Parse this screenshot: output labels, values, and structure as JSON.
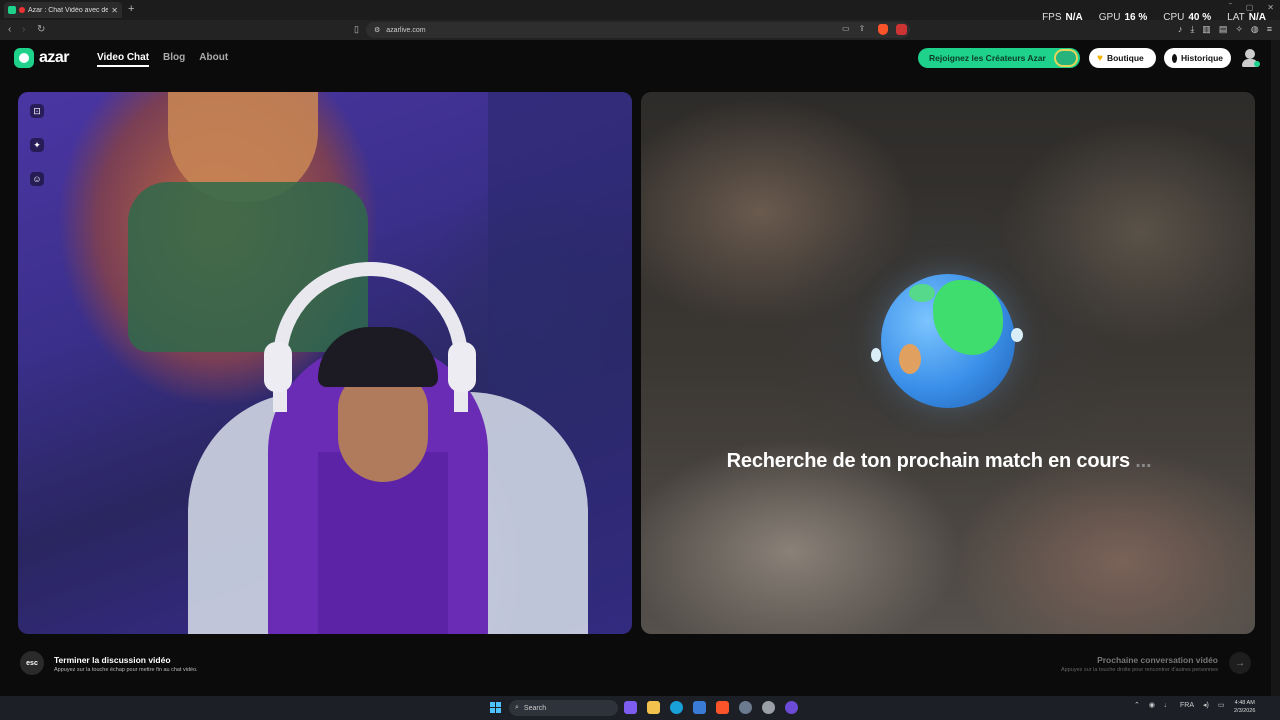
{
  "browser": {
    "tab_title": "Azar : Chat Vidéo avec de no",
    "url": "azarlive.com",
    "stats": [
      {
        "label": "FPS",
        "value": "N/A"
      },
      {
        "label": "GPU",
        "value": "16 %"
      },
      {
        "label": "CPU",
        "value": "40 %"
      },
      {
        "label": "LAT",
        "value": "N/A"
      }
    ]
  },
  "site": {
    "logo": "azar",
    "nav": [
      "Video Chat",
      "Blog",
      "About"
    ],
    "creators_button": "Rejoignez les Créateurs Azar",
    "shop_button": "Boutique",
    "history_button": "Historique",
    "accent_color": "#1ed28c"
  },
  "match": {
    "status_text": "Recherche de ton prochain match en cours",
    "dots": "..."
  },
  "controls": {
    "esc_key": "esc",
    "end_title": "Terminer la discussion vidéo",
    "end_sub": "Appuyez sur la touche échap pour mettre fin au chat vidéo.",
    "next_title": "Prochaine conversation vidéo",
    "next_sub": "Appuyez sur la touche droite pour rencontrer d'autres personnes"
  },
  "taskbar": {
    "search_placeholder": "Search",
    "lang": "FRA",
    "time": "4:48 AM",
    "date": "2/3/2026"
  }
}
